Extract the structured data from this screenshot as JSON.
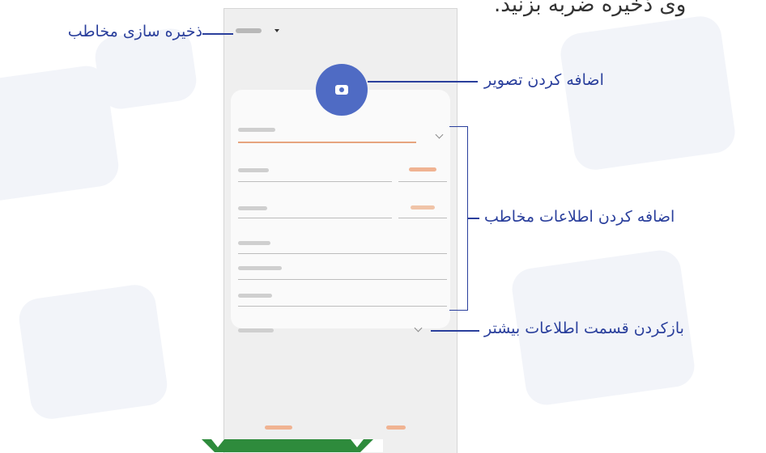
{
  "top_text": "وی ذخیره ضربه بزنید.",
  "annotations": {
    "save_contact": "ذخیره سازی مخاطب",
    "add_image": "اضافه کردن تصویر",
    "add_contact_info": "اضافه کردن اطلاعات مخاطب",
    "open_more_info": "بازکردن قسمت اطلاعات بیشتر"
  },
  "colors": {
    "accent_blue": "#4f6bc4",
    "annotation_blue": "#2a3f9c",
    "logo_green": "#2e8b3c"
  },
  "icons": {
    "camera": "camera-icon",
    "dropdown": "dropdown-arrow-icon",
    "chevron": "chevron-down-icon"
  }
}
